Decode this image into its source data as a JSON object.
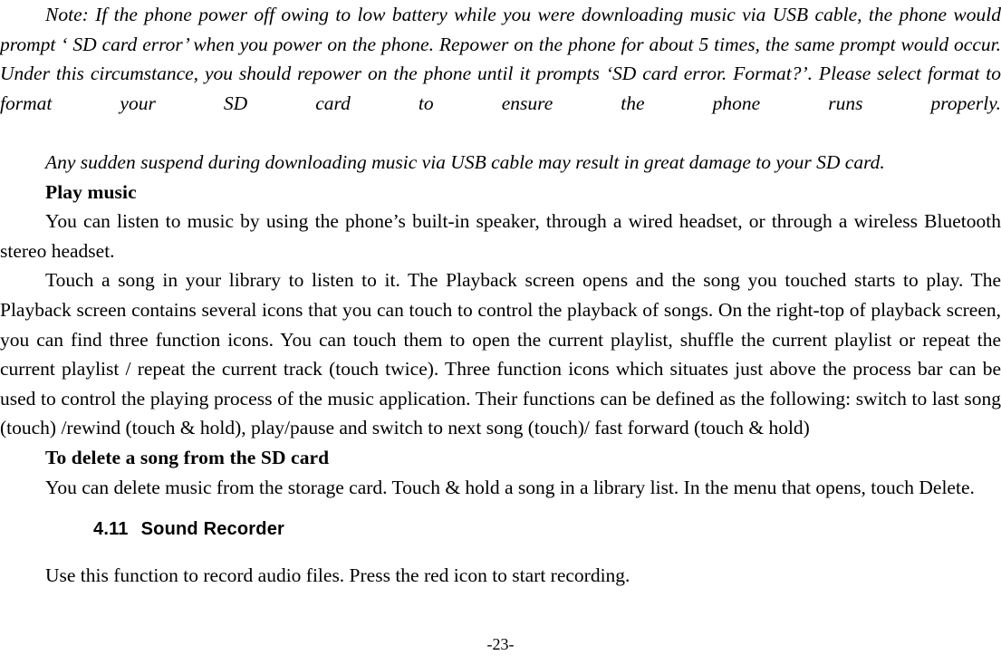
{
  "page": {
    "footer_page_number": "-23-",
    "background_color": "#ffffff",
    "text_color": "#000000"
  },
  "body": {
    "note_paragraph_1": "Note: If the phone power off owing to low battery while you were downloading music via USB cable, the phone would prompt ‘ SD card error’ when you power on the phone. Repower on the phone for about 5 times, the same prompt would occur. Under this circumstance, you should repower on the phone until it prompts ‘SD card error. Format?’. Please select format to format your SD card to ensure the phone runs properly.",
    "note_paragraph_2": "Any sudden suspend during downloading music via USB cable may result in great damage to your SD card.",
    "subheading_play_music": "Play music",
    "paragraph_listen": "You can listen to music by using the phone’s built-in speaker, through a wired headset, or through a wireless Bluetooth stereo headset.",
    "paragraph_playback": "Touch a song in your library to listen to it. The Playback screen opens and the song you touched starts to play. The Playback screen contains several icons that you can touch to control the playback of songs. On the right-top of playback screen, you can find three function icons. You can touch them to open the current playlist, shuffle the current playlist or repeat the current playlist / repeat the current track (touch twice). Three function icons which situates just above the process bar can be used to control the playing process of the music application. Their functions can be defined as the following: switch to last song (touch) /rewind (touch & hold), play/pause and switch to next song (touch)/ fast forward (touch & hold)",
    "subheading_delete_song": "To delete a song from the SD card",
    "paragraph_delete": "You can delete music from the storage card. Touch & hold a song in a library list. In the menu that opens, touch Delete."
  },
  "section": {
    "number": "4.11",
    "title": "Sound Recorder",
    "paragraph_intro": "Use this function to record audio files. Press the red icon to start recording."
  }
}
